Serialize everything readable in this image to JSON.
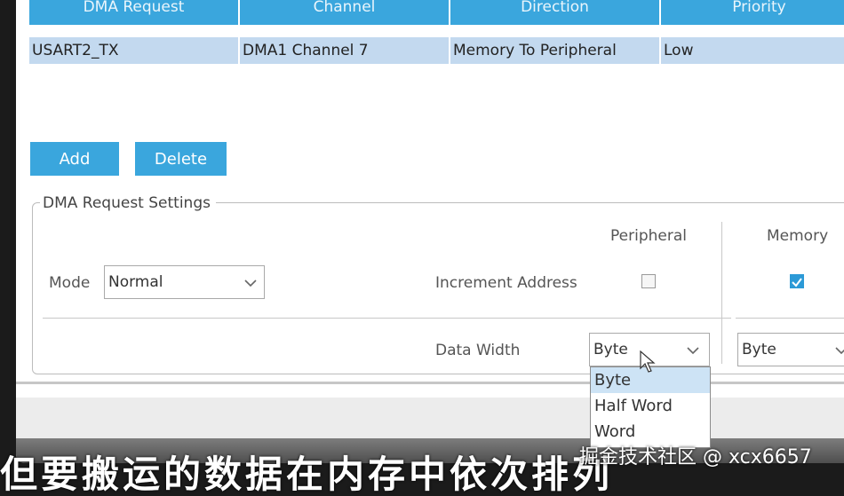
{
  "table": {
    "headers": [
      "DMA Request",
      "Channel",
      "Direction",
      "Priority"
    ],
    "rows": [
      [
        "USART2_TX",
        "DMA1 Channel 7",
        "Memory To Peripheral",
        "Low"
      ]
    ]
  },
  "buttons": {
    "add": "Add",
    "delete": "Delete"
  },
  "settings": {
    "title": "DMA Request Settings",
    "mode_label": "Mode",
    "mode_value": "Normal",
    "peripheral_label": "Peripheral",
    "memory_label": "Memory",
    "increment_label": "Increment Address",
    "peripheral_increment": false,
    "memory_increment": true,
    "data_width_label": "Data Width",
    "peripheral_width": "Byte",
    "memory_width": "Byte"
  },
  "dropdown": {
    "options": [
      "Byte",
      "Half Word",
      "Word"
    ],
    "selected": "Byte"
  },
  "overlay": {
    "subtitle": "但要搬运的数据在内存中依次排列",
    "watermark": "掘金技术社区 @ xcx6657"
  },
  "colors": {
    "accent": "#3aa6dd",
    "row_selected": "#c3d9ef",
    "checkbox_checked": "#2c9ad7"
  }
}
